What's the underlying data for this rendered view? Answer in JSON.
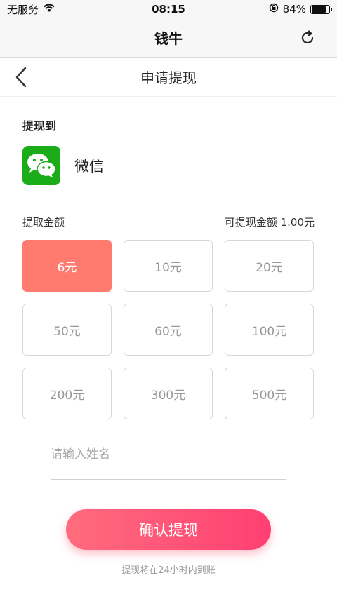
{
  "status_bar": {
    "carrier": "无服务",
    "time": "08:15",
    "battery_percent": "84%",
    "battery_level": 0.84
  },
  "header": {
    "app_title": "钱牛"
  },
  "nav": {
    "page_title": "申请提现"
  },
  "withdraw_to": {
    "label": "提现到",
    "method_name": "微信"
  },
  "amount": {
    "label": "提取金额",
    "available_text": "可提现金额 1.00元",
    "options": [
      {
        "label": "6元",
        "selected": true
      },
      {
        "label": "10元",
        "selected": false
      },
      {
        "label": "20元",
        "selected": false
      },
      {
        "label": "50元",
        "selected": false
      },
      {
        "label": "60元",
        "selected": false
      },
      {
        "label": "100元",
        "selected": false
      },
      {
        "label": "200元",
        "selected": false
      },
      {
        "label": "300元",
        "selected": false
      },
      {
        "label": "500元",
        "selected": false
      }
    ]
  },
  "name_input": {
    "placeholder": "请输入姓名",
    "value": ""
  },
  "confirm": {
    "label": "确认提现"
  },
  "note": "提现将在24小时内到账",
  "colors": {
    "selected_amount": "#ff7b6f",
    "confirm_gradient_start": "#ff6c7d",
    "confirm_gradient_end": "#ff3f73",
    "wechat_green": "#1aad19"
  }
}
